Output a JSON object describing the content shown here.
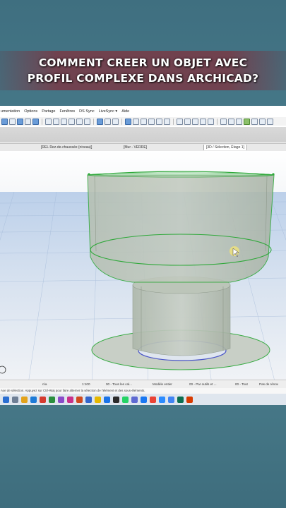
{
  "title": {
    "line1": "COMMENT CREER UN OBJET AVEC",
    "line2": "PROFIL COMPLEXE DANS ARCHICAD?"
  },
  "menu": [
    "umentation",
    "Options",
    "Partage",
    "Fenêtres",
    "DS Sync",
    "LiveSync ▾",
    "Aide"
  ],
  "tabs": {
    "tab1": "[REL Rez-de-chaussée (niveau)]",
    "tab2": "[Mur - VERRE]",
    "tab3": "[3D / Sélection, Étage 1]"
  },
  "status": {
    "undo": "n/a",
    "scale": "1:100",
    "layers": "00 - Tous les cal...",
    "model": "Modèle entier",
    "pen": "00 - Par outils et ...",
    "all": "00 - Tout",
    "renov": "Pas de rénov"
  },
  "hint": "Axe de sélection. Appuyez sur Ctrl+Maj pour faire alterner la sélection de l'élément et des sous-éléments.",
  "colors": {
    "accent": "#a8202e",
    "selection_green": "#2fa83a",
    "object_fill": "#b9c2b6"
  }
}
